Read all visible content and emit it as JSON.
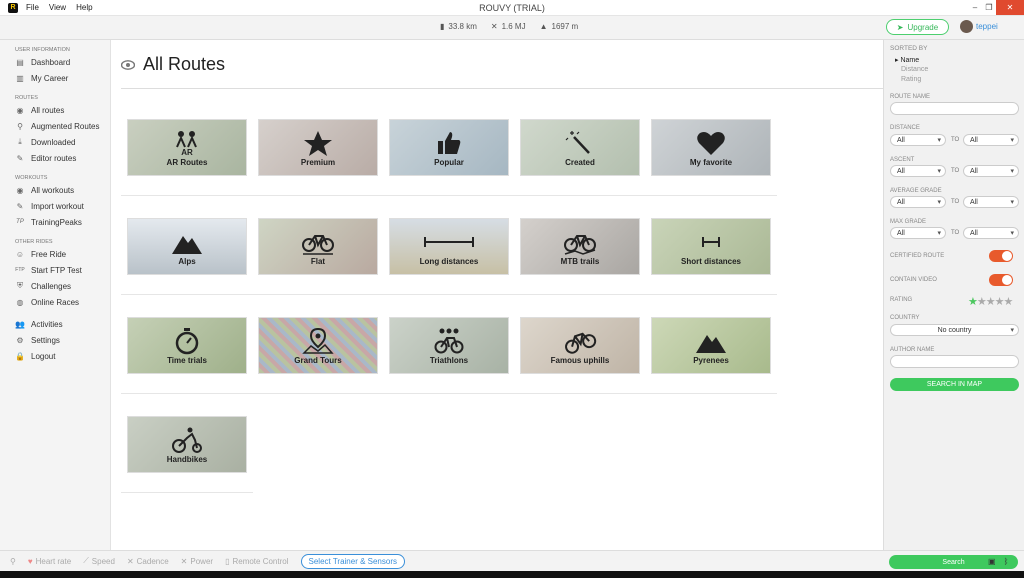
{
  "window": {
    "title": "ROUVY (TRIAL)",
    "menu": [
      "File",
      "View",
      "Help"
    ]
  },
  "stats": {
    "distance": "33.8 km",
    "energy": "1.6 MJ",
    "elevation": "1697 m"
  },
  "header": {
    "upgrade_label": "Upgrade",
    "username": "teppei"
  },
  "sidebar": {
    "sections": [
      {
        "title": "USER INFORMATION",
        "items": [
          "Dashboard",
          "My Career"
        ]
      },
      {
        "title": "ROUTES",
        "items": [
          "All routes",
          "Augmented Routes",
          "Downloaded",
          "Editor routes"
        ]
      },
      {
        "title": "WORKOUTS",
        "items": [
          "All workouts",
          "Import workout",
          "TrainingPeaks"
        ]
      },
      {
        "title": "OTHER RIDES",
        "items": [
          "Free Ride",
          "Start FTP Test",
          "Challenges",
          "Online Races"
        ]
      },
      {
        "title": "",
        "items": [
          "Activities",
          "Settings",
          "Logout"
        ]
      }
    ]
  },
  "main": {
    "title": "All Routes",
    "tiles": [
      [
        "AR Routes",
        "Premium",
        "Popular",
        "Created",
        "My favorite"
      ],
      [
        "Alps",
        "Flat",
        "Long distances",
        "MTB trails",
        "Short distances"
      ],
      [
        "Time trials",
        "Grand Tours",
        "Triathlons",
        "Famous uphills",
        "Pyrenees"
      ],
      [
        "Handbikes"
      ]
    ]
  },
  "filters": {
    "sorted_by": "SORTED BY",
    "sort_options": [
      "Name",
      "Distance",
      "Rating"
    ],
    "route_name": "ROUTE NAME",
    "distance": "DISTANCE",
    "ascent": "ASCENT",
    "average_grade": "AVERAGE GRADE",
    "max_grade": "MAX GRADE",
    "all": "All",
    "to": "TO",
    "certified_route": "CERTIFIED ROUTE",
    "contain_video": "CONTAIN VIDEO",
    "rating": "RATING",
    "rating_value": 1,
    "country": "COUNTRY",
    "country_value": "No country",
    "author_name": "AUTHOR NAME",
    "search_in_map": "SEARCH IN MAP",
    "search": "Search"
  },
  "bottombar": {
    "metrics": [
      "Heart rate",
      "Speed",
      "Cadence",
      "Power",
      "Remote Control"
    ],
    "sensor_button": "Select Trainer & Sensors"
  },
  "colors": {
    "accent_green": "#3ec95e",
    "toggle_orange": "#e85a2c",
    "link_blue": "#3a8fd9"
  }
}
